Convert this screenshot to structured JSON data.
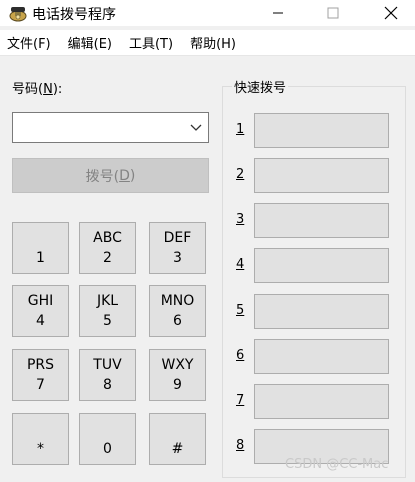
{
  "window": {
    "title": "电话拨号程序",
    "controls": {
      "minimize_icon": "minimize-icon",
      "maximize_icon": "maximize-icon",
      "close_icon": "close-icon"
    }
  },
  "menu": [
    {
      "label": "文件(F)"
    },
    {
      "label": "编辑(E)"
    },
    {
      "label": "工具(T)"
    },
    {
      "label": "帮助(H)"
    }
  ],
  "number": {
    "label_prefix": "号码(",
    "label_mnemonic": "N",
    "label_suffix": "):",
    "value": ""
  },
  "dial_button": {
    "label_prefix": "拨号(",
    "label_mnemonic": "D",
    "label_suffix": ")"
  },
  "keypad": [
    {
      "letters": "",
      "digit": "1"
    },
    {
      "letters": "ABC",
      "digit": "2"
    },
    {
      "letters": "DEF",
      "digit": "3"
    },
    {
      "letters": "GHI",
      "digit": "4"
    },
    {
      "letters": "JKL",
      "digit": "5"
    },
    {
      "letters": "MNO",
      "digit": "6"
    },
    {
      "letters": "PRS",
      "digit": "7"
    },
    {
      "letters": "TUV",
      "digit": "8"
    },
    {
      "letters": "WXY",
      "digit": "9"
    },
    {
      "letters": "",
      "digit": "*"
    },
    {
      "letters": "",
      "digit": "0"
    },
    {
      "letters": "",
      "digit": "#"
    }
  ],
  "speed_dial": {
    "title": "快速拨号",
    "entries": [
      {
        "number": "1"
      },
      {
        "number": "2"
      },
      {
        "number": "3"
      },
      {
        "number": "4"
      },
      {
        "number": "5"
      },
      {
        "number": "6"
      },
      {
        "number": "7"
      },
      {
        "number": "8"
      }
    ]
  },
  "watermark": "CSDN @CC-Mac"
}
